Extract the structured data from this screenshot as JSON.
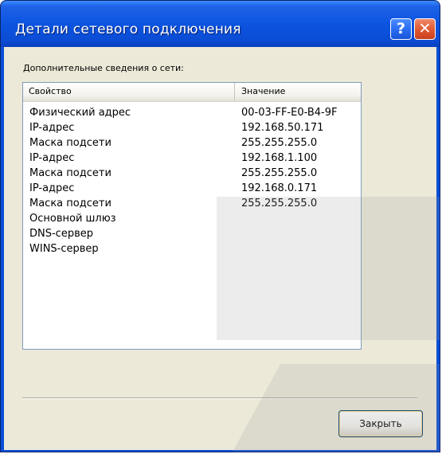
{
  "window": {
    "title": "Детали сетевого подключения",
    "help_glyph": "?",
    "close_glyph": "✕"
  },
  "info_label": "Дополнительные сведения о сети:",
  "list": {
    "columns": [
      "Свойство",
      "Значение"
    ],
    "rows": [
      {
        "property": "Физический адрес",
        "value": "00-03-FF-E0-B4-9F"
      },
      {
        "property": "IP-адрес",
        "value": "192.168.50.171"
      },
      {
        "property": "Маска подсети",
        "value": "255.255.255.0"
      },
      {
        "property": "IP-адрес",
        "value": "192.168.1.100"
      },
      {
        "property": "Маска подсети",
        "value": "255.255.255.0"
      },
      {
        "property": "IP-адрес",
        "value": "192.168.0.171"
      },
      {
        "property": "Маска подсети",
        "value": "255.255.255.0"
      },
      {
        "property": "Основной шлюз",
        "value": ""
      },
      {
        "property": "DNS-сервер",
        "value": ""
      },
      {
        "property": "WINS-сервер",
        "value": ""
      }
    ]
  },
  "buttons": {
    "close_label": "Закрыть"
  },
  "colors": {
    "titlebar": "#0c54e0",
    "client": "#ece9d8",
    "close_button": "#e25a33"
  }
}
